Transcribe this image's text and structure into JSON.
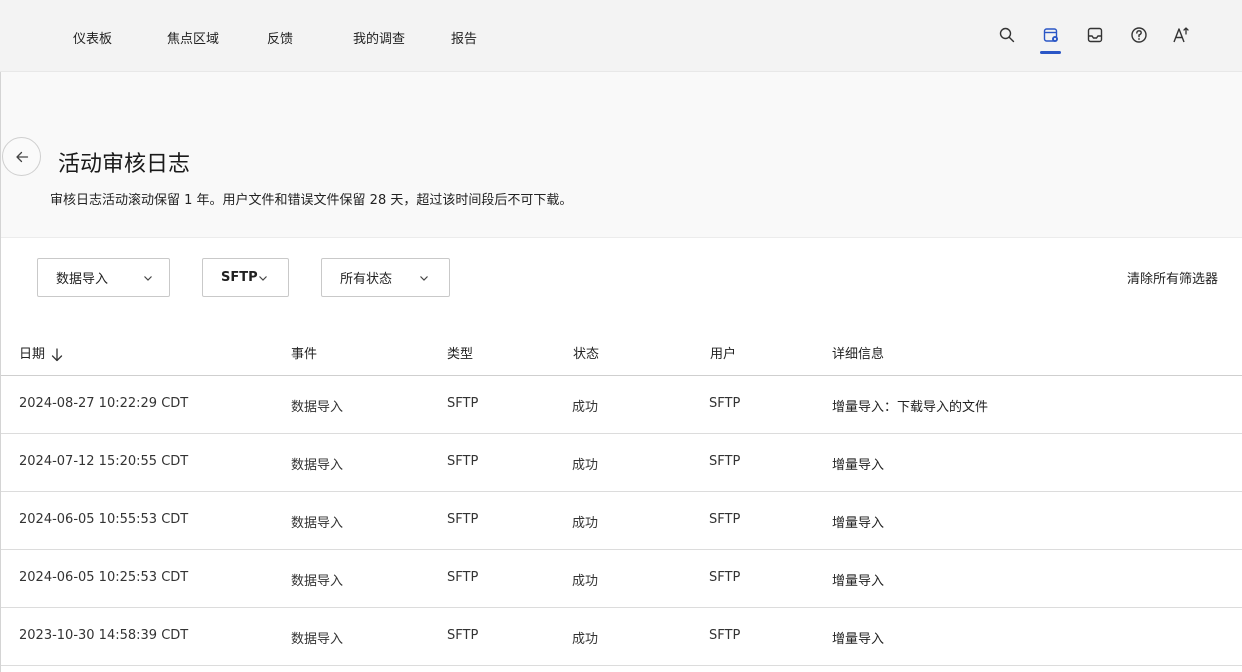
{
  "nav": {
    "items": [
      {
        "label": "仪表板"
      },
      {
        "label": "焦点区域"
      },
      {
        "label": "反馈"
      },
      {
        "label": "我的调查"
      },
      {
        "label": "报告"
      }
    ]
  },
  "top_icons": [
    "search-icon",
    "admin-calendar-gear-icon",
    "inbox-icon",
    "help-icon",
    "accessibility-text-icon"
  ],
  "colors": {
    "accent": "#2a56c6"
  },
  "page": {
    "title": "活动审核日志",
    "subtitle": "审核日志活动滚动保留 1 年。用户文件和错误文件保留 28 天，超过该时间段后不可下载。"
  },
  "filters": {
    "event_type": "数据导入",
    "source": "SFTP",
    "status": "所有状态",
    "clear_label": "清除所有筛选器"
  },
  "table": {
    "columns": [
      "日期",
      "事件",
      "类型",
      "状态",
      "用户",
      "详细信息"
    ],
    "rows": [
      {
        "date": "2024-08-27 10:22:29 CDT",
        "event": "数据导入",
        "type": "SFTP",
        "status": "成功",
        "user": "SFTP",
        "details": "增量导入：下载导入的文件"
      },
      {
        "date": "2024-07-12 15:20:55 CDT",
        "event": "数据导入",
        "type": "SFTP",
        "status": "成功",
        "user": "SFTP",
        "details": "增量导入"
      },
      {
        "date": "2024-06-05 10:55:53 CDT",
        "event": "数据导入",
        "type": "SFTP",
        "status": "成功",
        "user": "SFTP",
        "details": "增量导入"
      },
      {
        "date": "2024-06-05 10:25:53 CDT",
        "event": "数据导入",
        "type": "SFTP",
        "status": "成功",
        "user": "SFTP",
        "details": "增量导入"
      },
      {
        "date": "2023-10-30 14:58:39 CDT",
        "event": "数据导入",
        "type": "SFTP",
        "status": "成功",
        "user": "SFTP",
        "details": "增量导入"
      }
    ]
  }
}
